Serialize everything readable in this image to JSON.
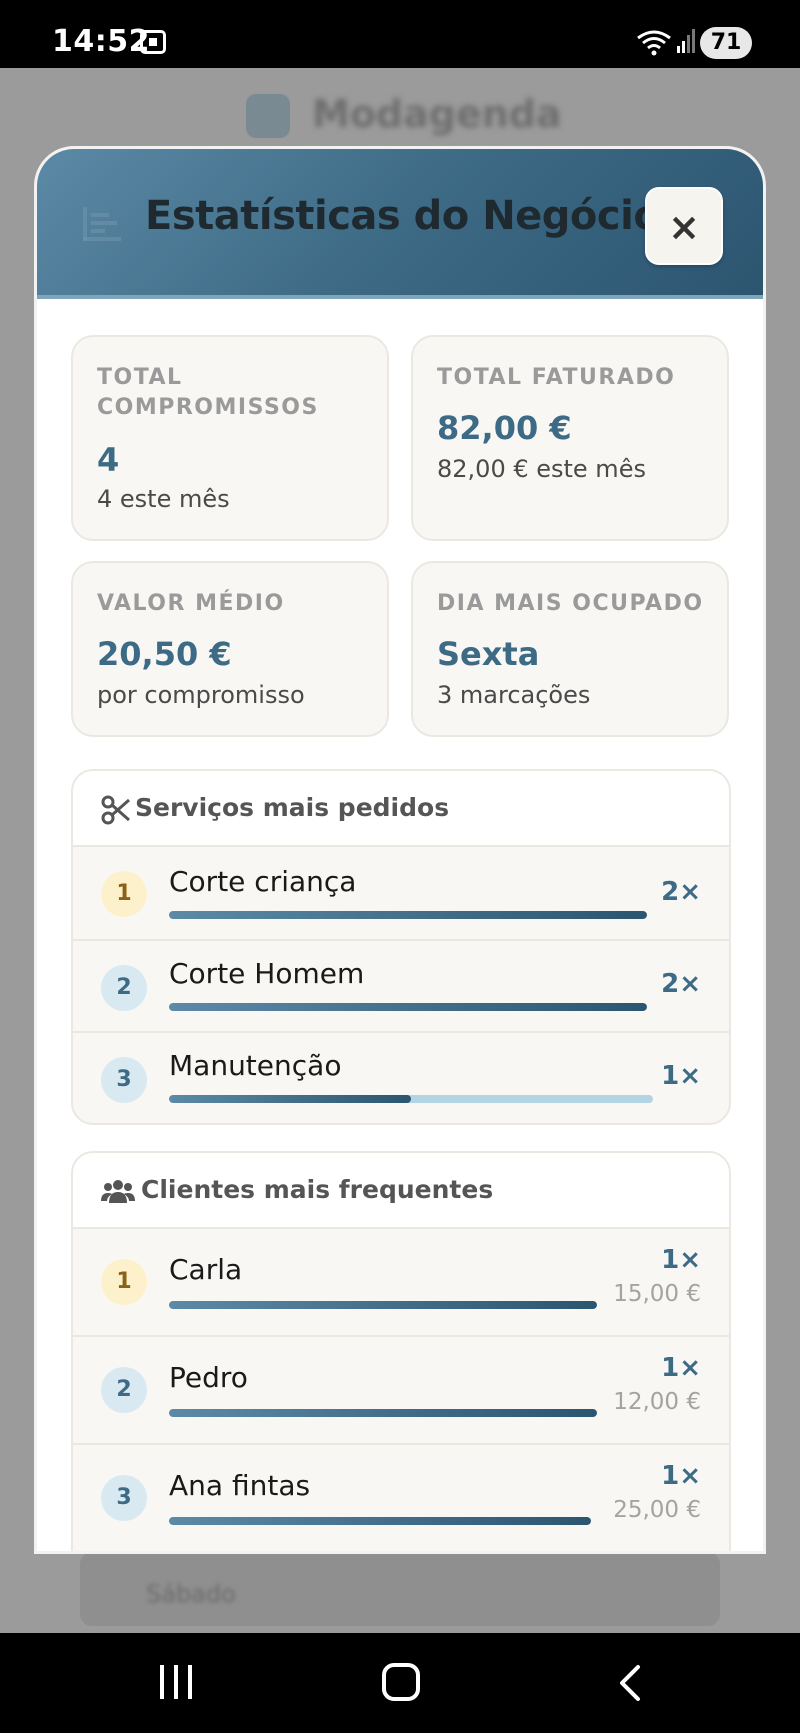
{
  "status_bar": {
    "time": "14:52",
    "battery": "71"
  },
  "background": {
    "app_name": "Modagenda",
    "footer_label": "Sábado"
  },
  "modal": {
    "title": "Estatísticas do Negócio",
    "close_label": "×"
  },
  "stats": [
    {
      "label": "TOTAL\nCOMPROMISSOS",
      "value": "4",
      "sub": "4 este mês"
    },
    {
      "label": "TOTAL FATURADO",
      "value": "82,00 €",
      "sub": "82,00 € este mês"
    },
    {
      "label": "VALOR MÉDIO",
      "value": "20,50 €",
      "sub": "por compromisso"
    },
    {
      "label": "DIA MAIS OCUPADO",
      "value": "Sexta",
      "sub": "3 marcações"
    }
  ],
  "services": {
    "title": "Serviços mais pedidos",
    "items": [
      {
        "rank": "1",
        "name": "Corte criança",
        "count": "2×",
        "fill": 1.0
      },
      {
        "rank": "2",
        "name": "Corte Homem",
        "count": "2×",
        "fill": 1.0
      },
      {
        "rank": "3",
        "name": "Manutenção",
        "count": "1×",
        "fill": 0.5
      }
    ]
  },
  "clients": {
    "title": "Clientes mais frequentes",
    "items": [
      {
        "rank": "1",
        "name": "Carla",
        "count": "1×",
        "amount": "15,00 €",
        "fill": 1.0
      },
      {
        "rank": "2",
        "name": "Pedro",
        "count": "1×",
        "amount": "12,00 €",
        "fill": 1.0
      },
      {
        "rank": "3",
        "name": "Ana fintas",
        "count": "1×",
        "amount": "25,00 €",
        "fill": 1.0
      }
    ]
  },
  "colors": {
    "accent": "#3d6a85",
    "bar_track": "#b3d4e3",
    "gold_badge": "#fdf1cc",
    "blue_badge": "#d9e9f1"
  },
  "icons": {
    "header": "bar-chart-icon",
    "services": "scissors-icon",
    "clients": "users-icon",
    "close": "close-icon"
  }
}
